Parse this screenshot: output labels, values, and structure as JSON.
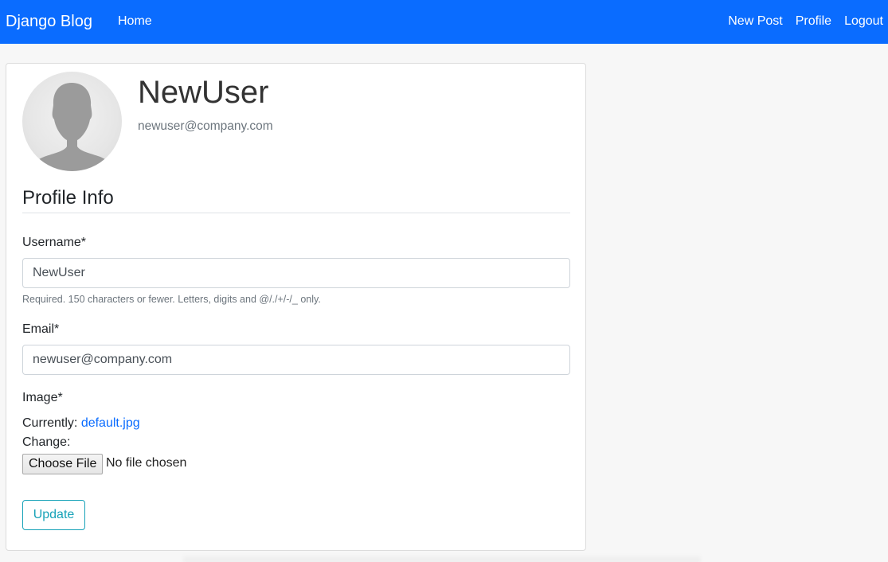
{
  "navbar": {
    "brand": "Django Blog",
    "home": "Home",
    "right_links": [
      "New Post",
      "Profile",
      "Logout"
    ],
    "color": "#0a6cff"
  },
  "profile": {
    "username": "NewUser",
    "email": "newuser@company.com"
  },
  "form": {
    "legend": "Profile Info",
    "username_label": "Username*",
    "username_value": "NewUser",
    "username_help": "Required. 150 characters or fewer. Letters, digits and @/./+/-/_ only.",
    "email_label": "Email*",
    "email_value": "newuser@company.com",
    "image_label": "Image*",
    "currently_label": "Currently:",
    "currently_file": "default.jpg",
    "change_label": "Change:",
    "choose_file_button": "Choose File",
    "no_file_text": "No file chosen",
    "submit_label": "Update",
    "submit_color": "#17a2b8"
  }
}
